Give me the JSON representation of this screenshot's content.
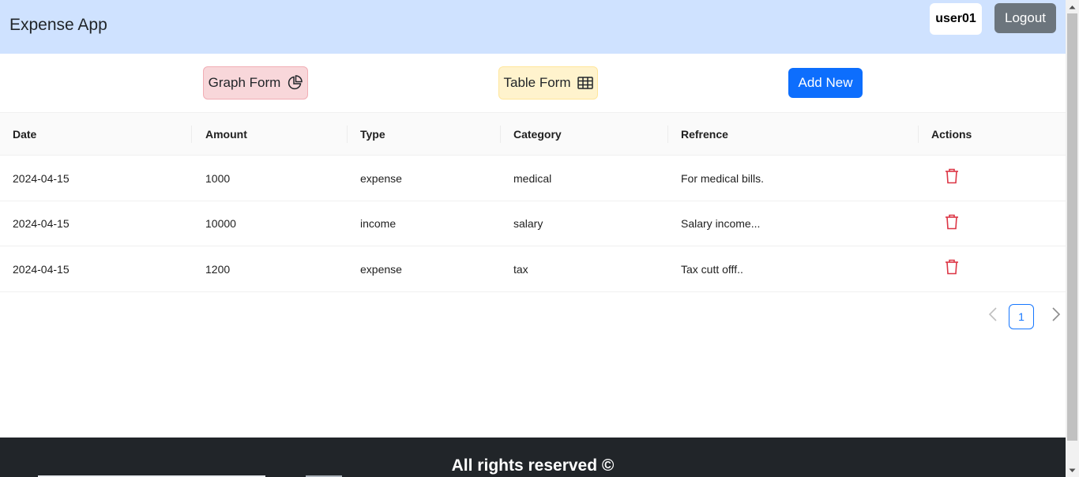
{
  "header": {
    "brand": "Expense App",
    "username": "user01",
    "logout_label": "Logout",
    "background": "#cfe2ff"
  },
  "toolbar": {
    "graph_label": "Graph Form",
    "graph_icon": "pie-chart-icon",
    "table_label": "Table Form",
    "table_icon": "table-grid-icon",
    "add_label": "Add New",
    "accent": "#0d6efd"
  },
  "table": {
    "columns": [
      "Date",
      "Amount",
      "Type",
      "Category",
      "Refrence",
      "Actions"
    ],
    "rows": [
      {
        "date": "2024-04-15",
        "amount": "1000",
        "type": "expense",
        "category": "medical",
        "reference": "For medical bills.",
        "action_icon": "trash-icon"
      },
      {
        "date": "2024-04-15",
        "amount": "10000",
        "type": "income",
        "category": "salary",
        "reference": "Salary income...",
        "action_icon": "trash-icon"
      },
      {
        "date": "2024-04-15",
        "amount": "1200",
        "type": "expense",
        "category": "tax",
        "reference": "Tax cutt offf..",
        "action_icon": "trash-icon"
      }
    ]
  },
  "pagination": {
    "current_page": "1"
  },
  "footer": {
    "text": "All rights reserved ©"
  }
}
